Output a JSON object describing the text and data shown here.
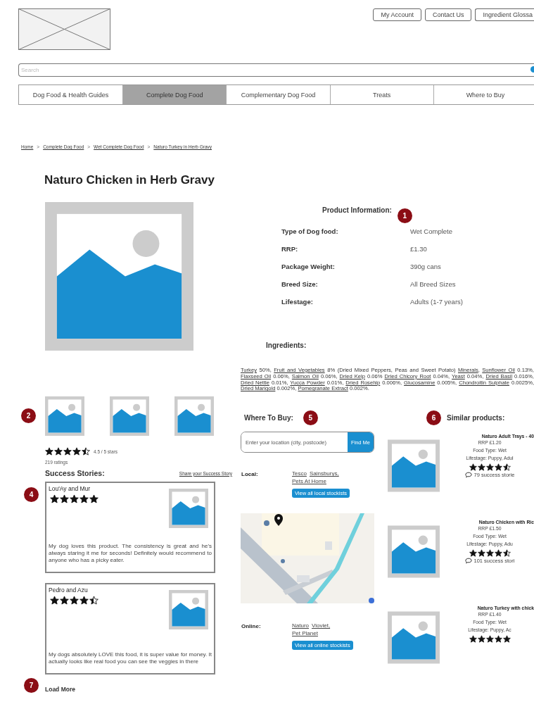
{
  "header": {
    "top_links": [
      "My Account",
      "Contact Us",
      "Ingredient Glossa"
    ],
    "search": {
      "placeholder": "Search"
    }
  },
  "nav_tabs": [
    {
      "label": "Dog Food & Health Guides",
      "selected": false
    },
    {
      "label": "Complete Dog Food",
      "selected": true
    },
    {
      "label": "Complementary Dog Food",
      "selected": false
    },
    {
      "label": "Treats",
      "selected": false
    },
    {
      "label": "Where to Buy",
      "selected": false
    }
  ],
  "breadcrumb": {
    "separator": ">",
    "items": [
      "Home",
      "Complete Dog Food",
      "Wet Complete Dog Food",
      "Naturo Turkey in Herb Gravy"
    ]
  },
  "product": {
    "title": "Naturo Chicken in Herb Gravy",
    "gallery_marker": "2",
    "rating": {
      "stars": 4.5,
      "text": "4.5 / 5 stars",
      "count": "219 ratings"
    }
  },
  "product_information": {
    "heading": "Product Information:",
    "marker": "1",
    "rows": [
      {
        "label": "Type of Dog food:",
        "value": "Wet Complete"
      },
      {
        "label": "RRP:",
        "value": "£1.30"
      },
      {
        "label": "Package Weight:",
        "value": "390g cans"
      },
      {
        "label": "Breed Size:",
        "value": "All Breed Sizes"
      },
      {
        "label": "Lifestage:",
        "value": "Adults (1-7 years)"
      }
    ]
  },
  "ingredients": {
    "heading": "Ingredients:",
    "segments": [
      {
        "text": "Turkey",
        "link": true
      },
      {
        "text": " 50%, ",
        "link": false
      },
      {
        "text": "Fruit and Vegetables",
        "link": true
      },
      {
        "text": " 8% (Dried Mixed Peppers, Peas and Sweet Potato) ",
        "link": false
      },
      {
        "text": "Minerals",
        "link": true
      },
      {
        "text": ", ",
        "link": false
      },
      {
        "text": "Sunflower Oil",
        "link": true
      },
      {
        "text": " 0.13%, ",
        "link": false
      },
      {
        "text": "Flaxseed Oil",
        "link": true
      },
      {
        "text": " 0.06%, ",
        "link": false
      },
      {
        "text": "Salmon Oil",
        "link": true
      },
      {
        "text": " 0.06%, ",
        "link": false
      },
      {
        "text": "Dried Kelp",
        "link": true
      },
      {
        "text": " 0.06% ",
        "link": false
      },
      {
        "text": "Dried Chicory Root",
        "link": true
      },
      {
        "text": " 0.04%, ",
        "link": false
      },
      {
        "text": "Yeast",
        "link": true
      },
      {
        "text": " 0.04%, ",
        "link": false
      },
      {
        "text": "Dried Basil",
        "link": true
      },
      {
        "text": " 0.016%, ",
        "link": false
      },
      {
        "text": "Dried Nettle",
        "link": true
      },
      {
        "text": " 0.01%, ",
        "link": false
      },
      {
        "text": "Yucca Powder",
        "link": true
      },
      {
        "text": " 0.01%, ",
        "link": false
      },
      {
        "text": "Dried Rosehip",
        "link": true
      },
      {
        "text": " 0.006%, ",
        "link": false
      },
      {
        "text": "Glucosamine",
        "link": true
      },
      {
        "text": " 0.005%, ",
        "link": false
      },
      {
        "text": "Chondroitin Sulphate",
        "link": true
      },
      {
        "text": " 0.0025%, ",
        "link": false
      },
      {
        "text": "Dried Marigold",
        "link": true
      },
      {
        "text": " 0.002%, ",
        "link": false
      },
      {
        "text": "Pomegranate Extract",
        "link": true
      },
      {
        "text": " 0.002%.",
        "link": false
      }
    ]
  },
  "success_stories": {
    "heading": "Success Stories:",
    "marker": "4",
    "share_link": "Share your Success Story",
    "stories": [
      {
        "author": "Lou'Ay and Mur",
        "stars": 5,
        "text": "My dog loves this product. The consistency is great and he's always staring it me for seconds! Definitely would recommend to anyone who has a picky eater."
      },
      {
        "author": "Pedro and Azu",
        "stars": 4.5,
        "text": "My dogs absolutely LOVE this food, it is super value for money. It actually looks like real food you can see the veggies in there"
      }
    ],
    "load_more": "Load More",
    "load_more_marker": "7"
  },
  "where_to_buy": {
    "heading": "Where To Buy:",
    "marker": "5",
    "location_placeholder": "Enter your location (city, postcode)",
    "find_button": "Find Me",
    "groups": [
      {
        "label": "Local:",
        "links": [
          "Tesco",
          "Sainsburys,",
          "Pets At Home"
        ],
        "button": "View all local stockists",
        "map": {
          "kind": "picture"
        }
      },
      {
        "label": "Online:",
        "links": [
          "Naturo",
          "Vioviet,",
          "Pet Planet"
        ],
        "button": "View all online stockists"
      }
    ]
  },
  "similar_products": {
    "heading": "Similar products:",
    "marker": "6",
    "items": [
      {
        "name": "Naturo Adult Trays - 40",
        "rrp": "RRP £1.20",
        "food_type": "Food Type: Wet",
        "lifestage": "Lifestage: Puppy, Adul",
        "stars": 4.5,
        "stories": "79 success storie"
      },
      {
        "name": "Naturo Chicken with Ric",
        "rrp": "RRP £1.50",
        "food_type": "Food Type: Wet",
        "lifestage": "Lifestage: Puppy, Adu",
        "stars": 4.5,
        "stories": "101 success stori"
      },
      {
        "name": "Naturo Turkey with chick",
        "rrp": "RRP £1.40",
        "food_type": "Food Type: Wet",
        "lifestage": "Lifestage: Puppy, Ac",
        "stars": 5
      }
    ]
  }
}
